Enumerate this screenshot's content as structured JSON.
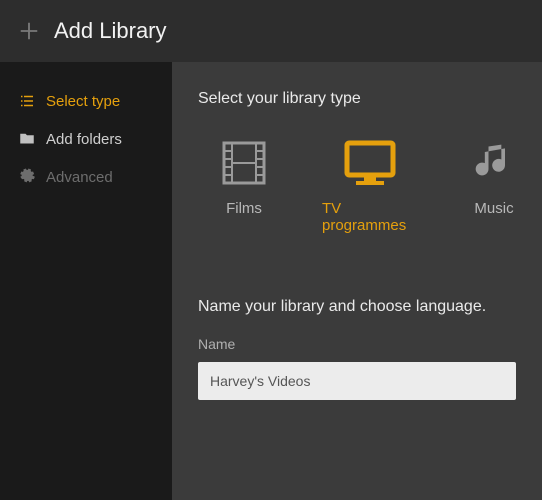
{
  "header": {
    "title": "Add Library"
  },
  "sidebar": {
    "items": [
      {
        "label": "Select type"
      },
      {
        "label": "Add folders"
      },
      {
        "label": "Advanced"
      }
    ]
  },
  "main": {
    "select_type_heading": "Select your library type",
    "types": [
      {
        "label": "Films"
      },
      {
        "label": "TV programmes"
      },
      {
        "label": "Music"
      }
    ],
    "name_heading": "Name your library and choose language.",
    "name_field_label": "Name",
    "name_value": "Harvey's Videos"
  },
  "colors": {
    "accent": "#e5a00d"
  }
}
